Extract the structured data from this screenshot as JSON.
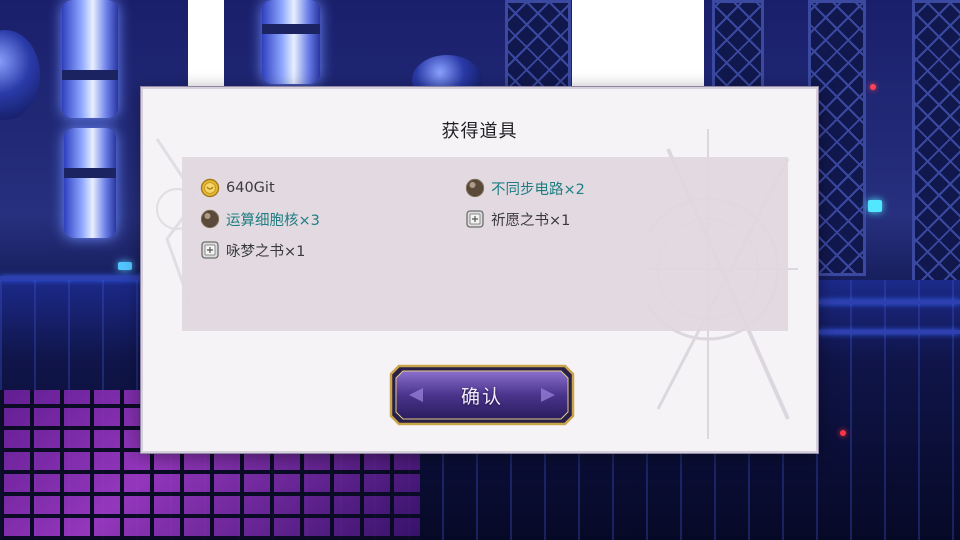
{
  "dialog": {
    "title": "获得道具",
    "items": [
      {
        "label": "640Git",
        "icon": "gold-coin-icon",
        "rarity": "normal"
      },
      {
        "label": "不同步电路×2",
        "icon": "dark-orb-icon",
        "rarity": "rare"
      },
      {
        "label": "运算细胞核×3",
        "icon": "dark-orb-icon",
        "rarity": "rare"
      },
      {
        "label": "祈愿之书×1",
        "icon": "book-icon",
        "rarity": "normal"
      },
      {
        "label": "咏梦之书×1",
        "icon": "book-icon",
        "rarity": "normal"
      }
    ],
    "confirm_label": "确认"
  },
  "colors": {
    "rare_text": "#1f7e83",
    "normal_text": "#3a3a3e",
    "dialog_bg": "#f6f3f6",
    "panel_bg": "#e1d8de",
    "button_gold": "#c9a54a",
    "button_purple": "#5a3f9c"
  }
}
